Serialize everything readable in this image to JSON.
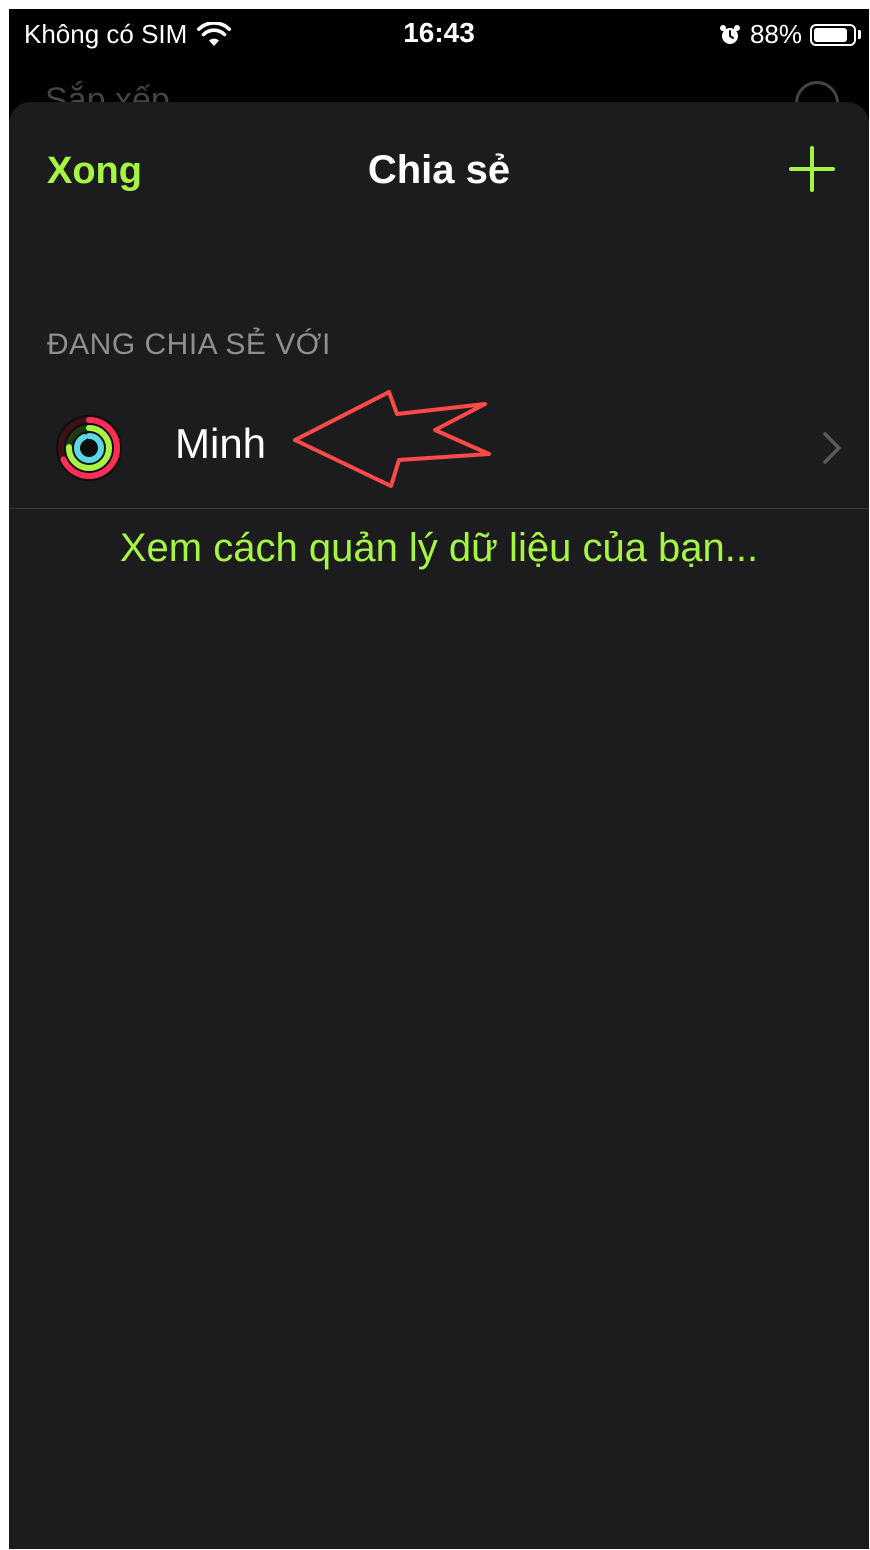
{
  "status_bar": {
    "carrier": "Không có SIM",
    "time": "16:43",
    "battery_percent": "88%",
    "battery_level": 0.88
  },
  "background_page": {
    "title": "Sắp xếp"
  },
  "sheet": {
    "done_label": "Xong",
    "title": "Chia sẻ",
    "add_icon": "plus-icon",
    "section_header": "ĐANG CHIA SẺ VỚI",
    "contacts": [
      {
        "name": "Minh",
        "icon": "activity-rings-icon"
      }
    ],
    "data_link": "Xem cách quản lý dữ liệu của bạn..."
  },
  "colors": {
    "accent": "#a6f542",
    "sheet_background": "#1c1c1e",
    "secondary_text": "#8e8e93",
    "annotation_arrow": "#ff4a4a"
  }
}
